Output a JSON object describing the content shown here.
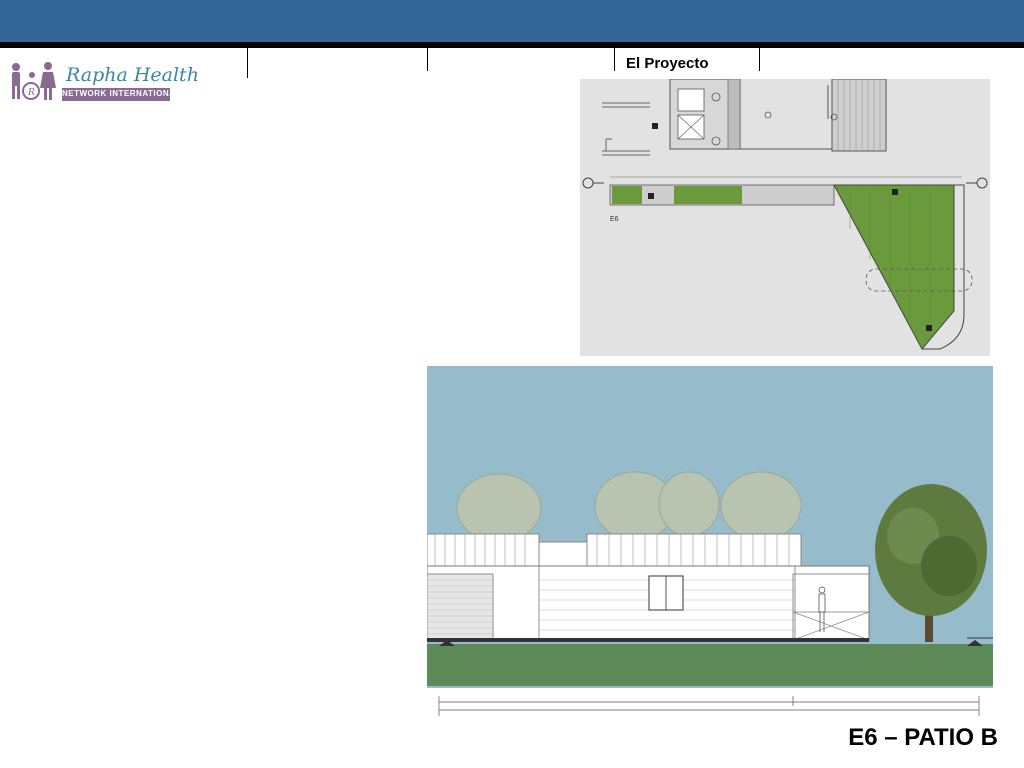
{
  "header": {
    "section_label": "El Proyecto",
    "band_color": "#336699"
  },
  "logo": {
    "name": "Rapha Health",
    "subtitle": "NETWORK INTERNATIONAL"
  },
  "drawings": {
    "plan_label": "E6"
  },
  "slide": {
    "title": "E6 – PATIO B"
  }
}
